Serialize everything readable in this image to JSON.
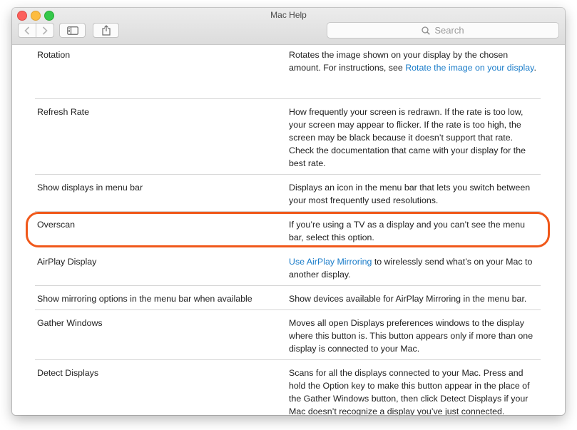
{
  "window": {
    "title": "Mac Help"
  },
  "toolbar": {
    "back_icon": "chevron-left-icon",
    "forward_icon": "chevron-right-icon",
    "sidebar_icon": "sidebar-icon",
    "share_icon": "share-icon"
  },
  "search": {
    "placeholder": "Search",
    "icon": "magnifier-icon"
  },
  "colors": {
    "link": "#1a7cc9",
    "highlight": "#f0581a"
  },
  "rows": [
    {
      "term": "Rotation",
      "desc_pre": "Rotates the image shown on your display by the chosen amount. For instructions, see ",
      "desc_link": "Rotate the image on your display",
      "desc_post": "."
    },
    {
      "term": "Refresh Rate",
      "desc_pre": "How frequently your screen is redrawn. If the rate is too low, your screen may appear to flicker. If the rate is too high, the screen may be black because it doesn’t support that rate. Check the documentation that came with your display for the best rate.",
      "desc_link": "",
      "desc_post": ""
    },
    {
      "term": "Show displays in menu bar",
      "desc_pre": "Displays an icon in the menu bar that lets you switch between your most frequently used resolutions.",
      "desc_link": "",
      "desc_post": ""
    },
    {
      "term": "Overscan",
      "desc_pre": "If you’re using a TV as a display and you can’t see the menu bar, select this option.",
      "desc_link": "",
      "desc_post": ""
    },
    {
      "term": "AirPlay Display",
      "desc_pre": "",
      "desc_link": "Use AirPlay Mirroring",
      "desc_post": " to wirelessly send what’s on your Mac to another display."
    },
    {
      "term": "Show mirroring options in the menu bar when available",
      "desc_pre": "Show devices available for AirPlay Mirroring in the menu bar.",
      "desc_link": "",
      "desc_post": ""
    },
    {
      "term": "Gather Windows",
      "desc_pre": "Moves all open Displays preferences windows to the display where this button is. This button appears only if more than one display is connected to your Mac.",
      "desc_link": "",
      "desc_post": ""
    },
    {
      "term": "Detect Displays",
      "desc_pre": "Scans for all the displays connected to your Mac. Press and hold the Option key to make this button appear in the place of the Gather Windows button, then click Detect Displays if your Mac doesn’t recognize a display you’ve just connected.",
      "desc_link": "",
      "desc_post": ""
    }
  ]
}
